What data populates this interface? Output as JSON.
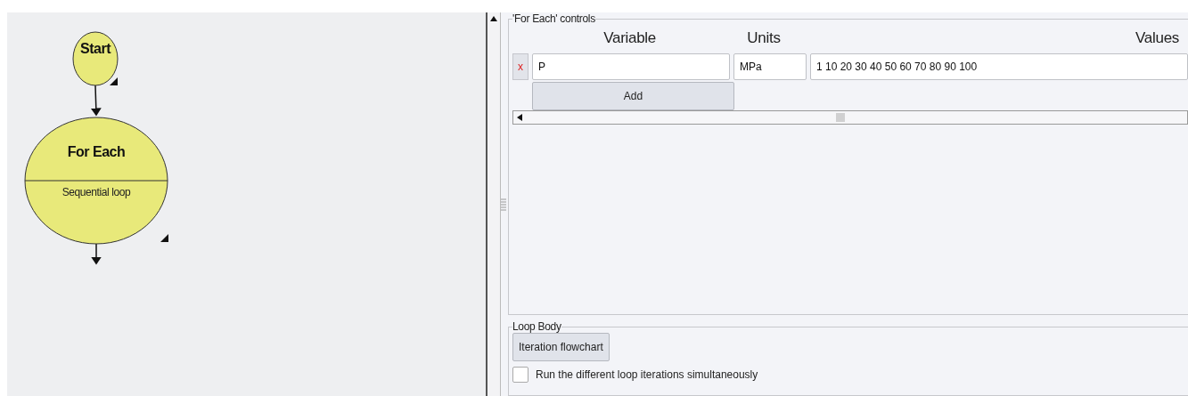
{
  "flowchart": {
    "nodes": [
      {
        "kind": "start",
        "label": "Start"
      },
      {
        "kind": "loop",
        "title": "For Each",
        "subtitle": "Sequential loop"
      }
    ]
  },
  "controls": {
    "legend": "'For Each' controls",
    "columns": [
      "Variable",
      "Units",
      "Values"
    ],
    "rows": [
      {
        "remove": "x",
        "variable": "P",
        "units": "MPa",
        "values": "1 10 20 30 40 50 60 70 80 90 100"
      }
    ],
    "add_button": "Add"
  },
  "loop_body": {
    "legend": "Loop Body",
    "button": "Iteration flowchart",
    "checkbox": {
      "label": "Run the different loop iterations simultaneously",
      "checked": false
    }
  }
}
